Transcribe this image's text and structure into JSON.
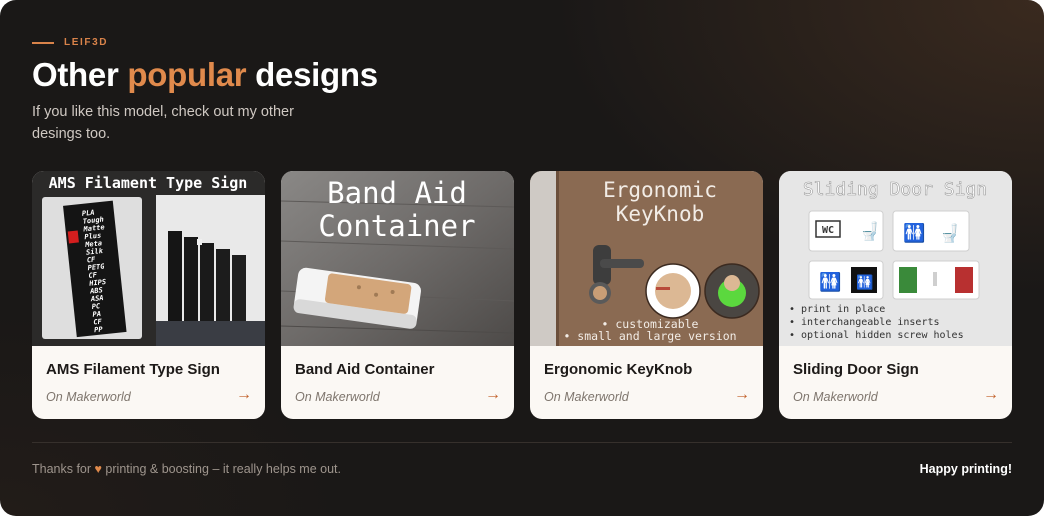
{
  "brand": "LEIF3D",
  "heading": {
    "before": "Other ",
    "accent": "popular",
    "after": " designs"
  },
  "subtitle": "If you like this model, check out my other desings too.",
  "accent_color": "#e08a4c",
  "cards": [
    {
      "title": "AMS Filament Type Sign",
      "meta": "On Makerworld",
      "arrow": "→",
      "image": {
        "heading": "AMS Filament Type Sign",
        "labels": [
          "PLA",
          "Tough",
          "Matte",
          "Plus",
          "Meta",
          "Silk",
          "CF",
          "PETG",
          "CF",
          "HIPS",
          "ABS",
          "ASA",
          "PC",
          "PA",
          "CF",
          "PP"
        ]
      }
    },
    {
      "title": "Band Aid Container",
      "meta": "On Makerworld",
      "arrow": "→",
      "image": {
        "line1": "Band Aid",
        "line2": "Container"
      }
    },
    {
      "title": "Ergonomic KeyKnob",
      "meta": "On Makerworld",
      "arrow": "→",
      "image": {
        "line1": "Ergonomic",
        "line2": "KeyKnob",
        "note1": "• customizable",
        "note2": "• small and large version"
      }
    },
    {
      "title": "Sliding Door Sign",
      "meta": "On Makerworld",
      "arrow": "→",
      "image": {
        "heading": "Sliding Door Sign",
        "wc": "WC",
        "bullets": [
          "• print in place",
          "• interchangeable inserts",
          "• optional hidden screw holes"
        ]
      }
    }
  ],
  "footer": {
    "left_before": "Thanks for ",
    "heart": "♥",
    "left_after": " printing & boosting – it really helps me out.",
    "right": "Happy printing!"
  }
}
